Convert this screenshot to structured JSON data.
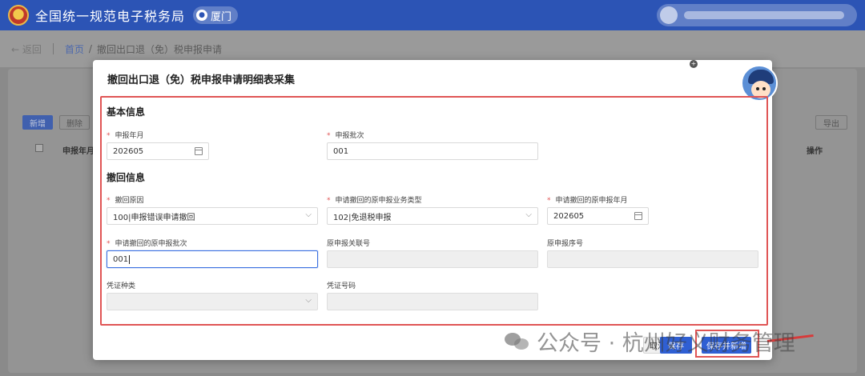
{
  "app": {
    "title": "全国统一规范电子税务局",
    "city": "厦门"
  },
  "breadcrumb": {
    "back_label": "返回",
    "home": "首页",
    "separator": "/",
    "current": "撤回出口退（免）税申报申请"
  },
  "background_page": {
    "add_button": "新增",
    "delete_button": "删除",
    "export_button": "导出",
    "table_headers": [
      "申报年月",
      "操作"
    ]
  },
  "modal": {
    "title": "撤回出口退（免）税申报申请明细表采集",
    "close_glyph": "+",
    "sections": {
      "basic": "基本信息",
      "revoke": "撤回信息"
    },
    "fields": {
      "declare_month": {
        "label": "申报年月",
        "value": "202605",
        "required": true
      },
      "declare_batch": {
        "label": "申报批次",
        "value": "001",
        "required": true
      },
      "revoke_reason": {
        "label": "撤回原因",
        "value": "100|申报错误申请撤回",
        "required": true
      },
      "orig_business_type": {
        "label": "申请撤回的原申报业务类型",
        "value": "102|免退税申报",
        "required": true
      },
      "orig_declare_month": {
        "label": "申请撤回的原申报年月",
        "value": "202605",
        "required": true
      },
      "orig_declare_batch": {
        "label": "申请撤回的原申报批次",
        "value": "001",
        "required": true
      },
      "orig_link_no": {
        "label": "原申报关联号",
        "value": "",
        "required": false
      },
      "orig_seq_no": {
        "label": "原申报序号",
        "value": "",
        "required": false
      },
      "voucher_type": {
        "label": "凭证种类",
        "value": "",
        "required": false
      },
      "voucher_no": {
        "label": "凭证号码",
        "value": "",
        "required": false
      }
    },
    "required_mark": "*",
    "buttons": {
      "cancel": "取消",
      "save": "保存",
      "save_new": "保存并新增"
    }
  },
  "watermark": {
    "text": "公众号 · 杭州好义财务管理"
  },
  "colors": {
    "header_blue": "#2c54b5",
    "primary": "#2f5fd3",
    "annotation_red": "#e05555",
    "required_red": "#e05555"
  }
}
